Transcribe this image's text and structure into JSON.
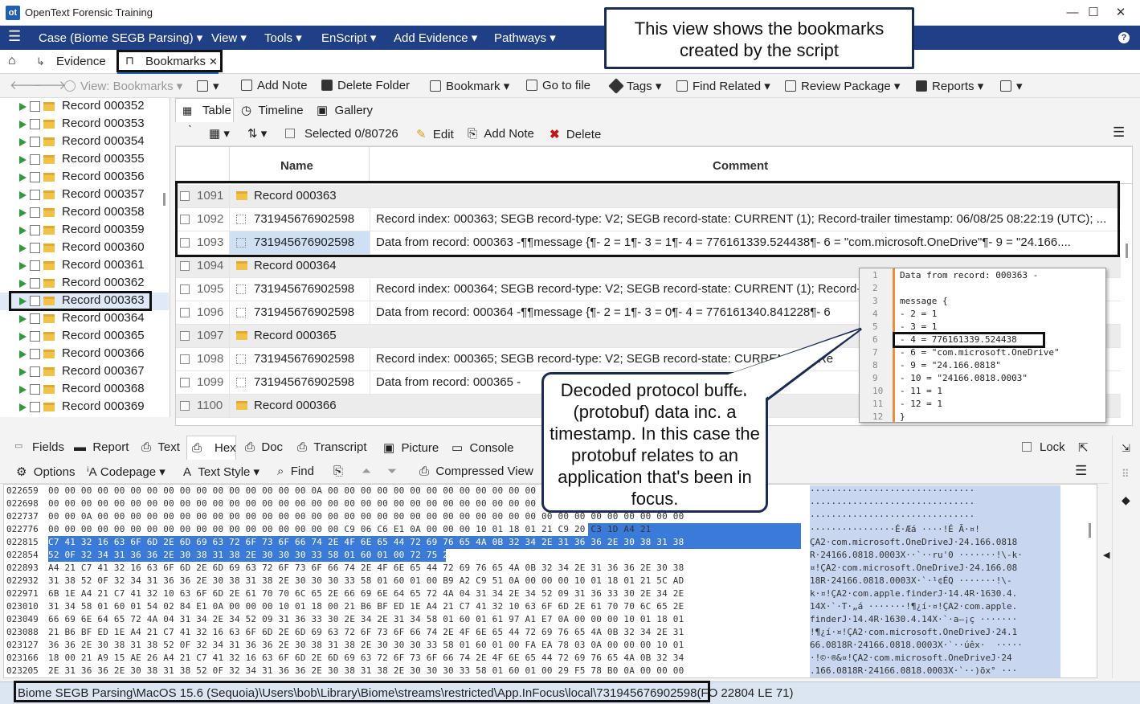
{
  "window": {
    "title": "OpenText Forensic Training",
    "logo": "ot",
    "min": "—",
    "max": "☐",
    "close": "✕"
  },
  "menubar": {
    "hamburger": "☰",
    "items": [
      "Case (Biome SEGB Parsing)",
      "View",
      "Tools",
      "EnScript",
      "Add Evidence",
      "Pathways"
    ],
    "help": "?"
  },
  "tabs": {
    "home_icon": "home-icon",
    "items": [
      {
        "label": "Evidence"
      },
      {
        "label": "Bookmarks"
      }
    ]
  },
  "toolbar1": {
    "back": "🡐",
    "forward": "🡒",
    "view": "View: Bookmarks",
    "add_note": "Add Note",
    "delete_folder": "Delete Folder",
    "bookmark": "Bookmark",
    "go_to_file": "Go to file",
    "tags": "Tags",
    "find_related": "Find Related",
    "review_package": "Review Package",
    "reports": "Reports"
  },
  "tree": {
    "items": [
      "Record 000352",
      "Record 000353",
      "Record 000354",
      "Record 000355",
      "Record 000356",
      "Record 000357",
      "Record 000358",
      "Record 000359",
      "Record 000360",
      "Record 000361",
      "Record 000362",
      "Record 000363",
      "Record 000364",
      "Record 000365",
      "Record 000366",
      "Record 000367",
      "Record 000368",
      "Record 000369"
    ]
  },
  "view_tabs": [
    "Table",
    "Timeline",
    "Gallery"
  ],
  "toolbar2": {
    "selected": "Selected 0/80726",
    "edit": "Edit",
    "add_note": "Add Note",
    "delete": "Delete"
  },
  "table": {
    "columns": [
      "Name",
      "Comment"
    ],
    "rows": [
      {
        "num": "1091",
        "type": "folder",
        "name": "Record 000363",
        "comment": ""
      },
      {
        "num": "1092",
        "type": "data",
        "name": "731945676902598",
        "comment": "Record index: 000363; SEGB record-type: V2; SEGB record-state: CURRENT (1); Record-trailer timestamp: 06/08/25 08:22:19 (UTC); ..."
      },
      {
        "num": "1093",
        "type": "data",
        "name": "731945676902598",
        "comment": "Data from record: 000363 -¶¶message {¶- 2 = 1¶- 3 = 1¶- 4 = 776161339.524438¶- 6 = \"com.microsoft.OneDrive\"¶- 9 = \"24.166...."
      },
      {
        "num": "1094",
        "type": "folder",
        "name": "Record 000364",
        "comment": ""
      },
      {
        "num": "1095",
        "type": "data",
        "name": "731945676902598",
        "comment": "Record index: 000364; SEGB record-type: V2; SEGB record-state: CURRENT (1); Record-tr"
      },
      {
        "num": "1096",
        "type": "data",
        "name": "731945676902598",
        "comment": "Data from record: 000364 -¶¶message {¶- 2 = 1¶- 3 = 0¶- 4 = 776161340.841228¶- 6"
      },
      {
        "num": "1097",
        "type": "folder",
        "name": "Record 000365",
        "comment": ""
      },
      {
        "num": "1098",
        "type": "data",
        "name": "731945676902598",
        "comment": "Record index: 000365; SEGB record-type: V2; SEGB record-state: CURRENT (1); Re"
      },
      {
        "num": "1099",
        "type": "data",
        "name": "731945676902598",
        "comment": "Data from record: 000365 -"
      },
      {
        "num": "1100",
        "type": "folder",
        "name": "Record 000366",
        "comment": ""
      }
    ]
  },
  "popup": {
    "lines": [
      "Data from record: 000363 -",
      "",
      "message {",
      "- 2 = 1",
      "- 3 = 1",
      "- 4 = 776161339.524438",
      "- 6 = \"com.microsoft.OneDrive\"",
      "- 9 = \"24.166.0818\"",
      "- 10 = \"24166.0818.0003\"",
      "- 11 = 1",
      "- 12 = 1",
      "}"
    ]
  },
  "bottom_tabs": [
    "Fields",
    "Report",
    "Text",
    "Hex",
    "Doc",
    "Transcript",
    "Picture",
    "Console"
  ],
  "lock": "Lock",
  "toolbar3": {
    "options": "Options",
    "codepage": "Codepage",
    "text_style": "Text Style",
    "find": "Find",
    "compressed_view": "Compressed View"
  },
  "hex": {
    "rows": [
      {
        "off": "022659",
        "bytes": "00 00 00 00 00 00 00 00 00 00 00 00 00 00 00 00 0A 00 00 00 00 00 00 00 00 00 00 00 00 00 00 00 00 00 00 00 00 00 00",
        "ascii": "·······························"
      },
      {
        "off": "022698",
        "bytes": "00 00 00 00 00 00 00 00 00 00 00 00 00 00 00 00 00 00 00 00 00 00 00 00 00 00 00 00 00 00 00 00 00 00 00 00 00 00 00",
        "ascii": "·······························"
      },
      {
        "off": "022737",
        "bytes": "00 00 0A 00 00 00 00 00 00 00 00 00 00 00 00 00 00 00 00 00 00 00 00 00 00 00 00 00 00 00 00 00 00 00 00 00 00 00 00",
        "ascii": "·······························"
      },
      {
        "off": "022776",
        "bytes": "00 00 00 00 00 00 00 00 00 00 00 00 00 00 00 00 00 00 C9 06 C6 E1 0A 00 00 00 10 01 18 01 21 C9 20 C3 1D A4 21",
        "ascii": "················É·Æá ····!É Ã·¤!"
      },
      {
        "off": "022815",
        "bytes": "C7 41 32 16 63 6F 6D 2E 6D 69 63 72 6F 73 6F 66 74 2E 4F 6E 65 44 72 69 76 65 4A 0B 32 34 2E 31 36 36 2E 30 38 31 38",
        "ascii": "ÇA2·com.microsoft.OneDriveJ·24.166.0818"
      },
      {
        "off": "022854",
        "bytes": "52 0F 32 34 31 36 36 2E 30 38 31 38 2E 30 30 30 33 58 01 60 01 00 72 75 27 30 0A 00 00 10 01 18 00 21 5C AD 6B 1E",
        "ascii": "R·24166.0818.0003X··`··ru'0 ·······!\\-k·"
      },
      {
        "off": "022893",
        "bytes": "A4 21 C7 41 32 16 63 6F 6D 2E 6D 69 63 72 6F 73 6F 66 74 2E 4F 6E 65 44 72 69 76 65 4A 0B 32 34 2E 31 36 36 2E 30 38",
        "ascii": "¤!ÇA2·com.microsoft.OneDriveJ·24.166.08"
      },
      {
        "off": "022932",
        "bytes": "31 38 52 0F 32 34 31 36 36 2E 30 38 31 38 2E 30 30 30 33 58 01 60 01 00 B9 A2 C9 51 0A 00 00 00 10 01 18 01 21 5C AD",
        "ascii": "18R·24166.0818.0003X·`·¹¢ÉQ ·······!\\-"
      },
      {
        "off": "022971",
        "bytes": "6B 1E A4 21 C7 41 32 10 63 6F 6D 2E 61 70 70 6C 65 2E 66 69 6E 64 65 72 4A 04 31 34 2E 34 52 09 31 36 33 30 2E 34 2E",
        "ascii": "k·¤!ÇA2·com.apple.finderJ·14.4R·1630.4."
      },
      {
        "off": "023010",
        "bytes": "31 34 58 01 60 01 54 02 84 E1 0A 00 00 00 10 01 18 00 21 B6 BF ED 1E A4 21 C7 41 32 10 63 6F 6D 2E 61 70 70 6C 65 2E",
        "ascii": "14X·`·T·„á ·······!¶¿í·¤!ÇA2·com.apple."
      },
      {
        "off": "023049",
        "bytes": "66 69 6E 64 65 72 4A 04 31 34 2E 34 52 09 31 36 33 30 2E 34 2E 31 34 58 01 60 01 61 97 A1 E7 0A 00 00 00 10 01 18 01",
        "ascii": "finderJ·14.4R·1630.4.14X·`·a—¡ç ·······"
      },
      {
        "off": "023088",
        "bytes": "21 B6 BF ED 1E A4 21 C7 41 32 16 63 6F 6D 2E 6D 69 63 72 6F 73 6F 66 74 2E 4F 6E 65 44 72 69 76 65 4A 0B 32 34 2E 31",
        "ascii": "!¶¿í·¤!ÇA2·com.microsoft.OneDriveJ·24.1"
      },
      {
        "off": "023127",
        "bytes": "36 36 2E 30 38 31 38 52 0F 32 34 31 36 36 2E 30 38 31 38 2E 30 30 30 33 58 01 60 01 00 FA EA 78 03 0A 00 00 00 10 01",
        "ascii": "66.0818R·24166.0818.0003X·`··úêx·  ·····"
      },
      {
        "off": "023166",
        "bytes": "18 00 21 A9 15 AE 26 A4 21 C7 41 32 16 63 6F 6D 2E 6D 69 63 72 6F 73 6F 66 74 2E 4F 6E 65 44 72 69 76 65 4A 0B 32 34",
        "ascii": "·!©·®&¤!ÇA2·com.microsoft.OneDriveJ·24"
      },
      {
        "off": "023205",
        "bytes": "2E 31 36 36 2E 30 38 31 38 52 0F 32 34 31 36 36 2E 30 38 31 38 2E 30 30 30 33 58 01 60 01 00 29 F5 78 B0 0A 00 00 00",
        "ascii": ".166.0818R·24166.0818.0003X·`··)õx° ···"
      }
    ]
  },
  "status": {
    "path": "Biome SEGB Parsing\\MacOS 15.6 (Sequoia)\\Users\\bob\\Library\\Biome\\streams\\restricted\\App.InFocus\\local\\731945676902598",
    "extra": "(FO 22804 LE 71)"
  },
  "annotations": {
    "top": "This view shows the bookmarks created by the script",
    "bottom": "Decoded protocol buffer (protobuf) data inc. a timestamp. In this case the protobuf relates to an application that's been in focus."
  }
}
